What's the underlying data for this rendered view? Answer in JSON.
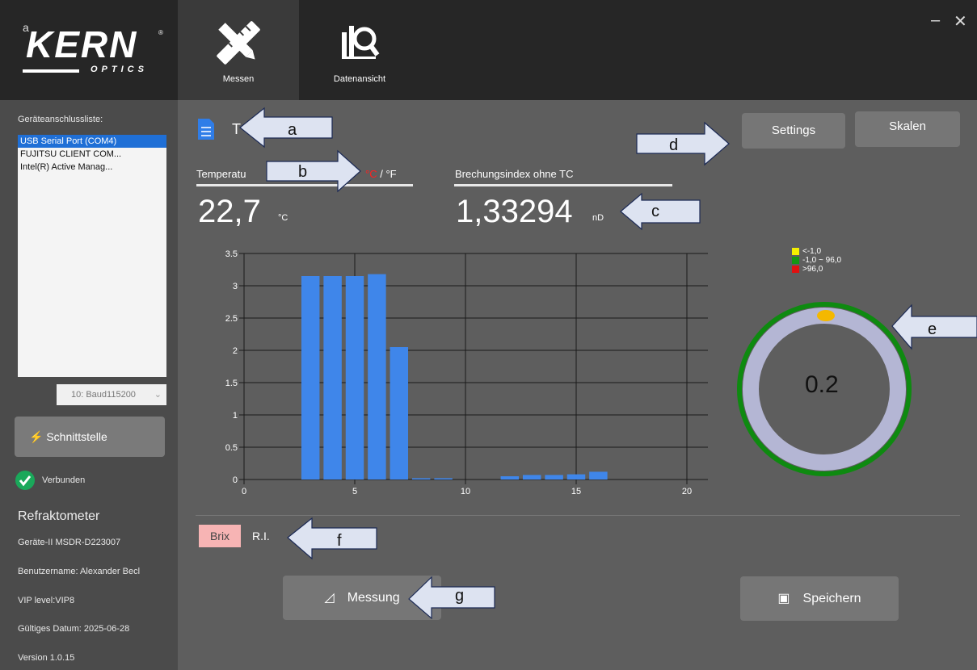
{
  "window": {
    "minimize": "–",
    "close": "✕"
  },
  "brand": {
    "corner_letter": "a",
    "name": "KERN",
    "sub": "OPTICS",
    "registered": "®"
  },
  "tabs": [
    {
      "label": "Messen",
      "icon": "ruler-pencil-icon"
    },
    {
      "label": "Datenansicht",
      "icon": "chart-magnifier-icon"
    }
  ],
  "sidebar": {
    "list_title": "Geräteanschlussliste:",
    "devices": [
      "USB Serial Port (COM4)",
      "FUJITSU CLIENT COM...",
      "Intel(R) Active Manag..."
    ],
    "baud": "10: Baud115200",
    "interface_button": "Schnittstelle",
    "status": "Verbunden",
    "device_type": "Refraktometer",
    "device_id": "Geräte-II MSDR-D223007",
    "username": "Benutzername: Alexander Becl",
    "vip": "VIP level:VIP8",
    "valid_date": "Gültiges Datum: 2025-06-28",
    "version": "Version 1.0.15"
  },
  "main": {
    "doc_title": "T",
    "temp_label": "Temperatu",
    "unit_c": "°C",
    "unit_sep": " / ",
    "unit_f": "°F",
    "temp_value": "22,7",
    "temp_unit": "°C",
    "ri_label": "Brechungsindex ohne TC",
    "ri_value": "1,33294",
    "ri_unit": "nD",
    "settings_button": "Settings",
    "scales_button": "Skalen",
    "mode_brix": "Brix",
    "mode_ri": "R.I.",
    "measure_button": "Messung",
    "save_button": "Speichern"
  },
  "gauge": {
    "value": "0.2",
    "legend": [
      {
        "label": "<-1,0",
        "color": "#f4f000"
      },
      {
        "label": "-1,0 ~ 96,0",
        "color": "#149614"
      },
      {
        "label": ">96,0",
        "color": "#e01010"
      }
    ]
  },
  "callouts": [
    "a",
    "b",
    "c",
    "d",
    "e",
    "f",
    "g"
  ],
  "chart_data": {
    "type": "bar",
    "x": [
      3,
      4,
      5,
      6,
      7,
      8,
      9,
      12,
      13,
      14,
      15,
      16
    ],
    "values": [
      3.15,
      3.15,
      3.15,
      3.18,
      2.05,
      0.02,
      0.02,
      0.05,
      0.07,
      0.07,
      0.08,
      0.12
    ],
    "xlim": [
      0,
      20
    ],
    "ylim": [
      0,
      3.5
    ],
    "x_ticks": [
      "0",
      "5",
      "10",
      "15",
      "20"
    ],
    "y_ticks": [
      "0",
      "0.5",
      "1",
      "1.5",
      "2",
      "2.5",
      "3",
      "3.5"
    ],
    "grid": true,
    "bar_color": "#3f86ea"
  }
}
